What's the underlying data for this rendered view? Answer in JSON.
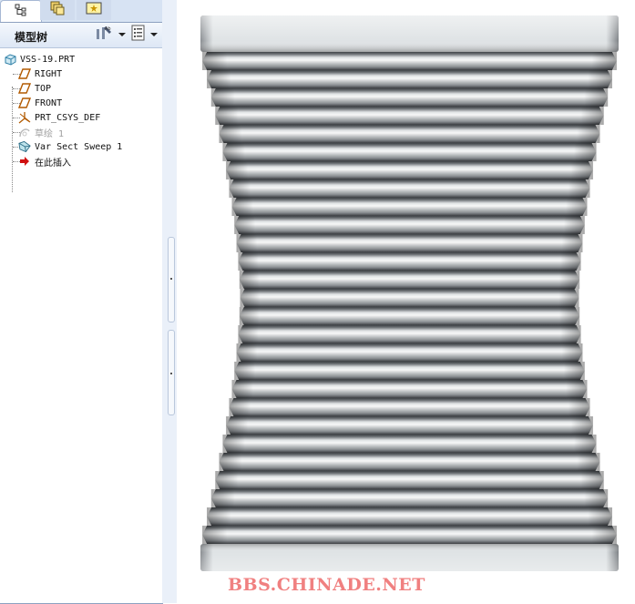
{
  "navigator": {
    "tabs": [
      {
        "name": "model-tree",
        "icon": "model-tree-icon",
        "active": true
      },
      {
        "name": "layers",
        "icon": "layers-icon",
        "active": false
      },
      {
        "name": "favorites",
        "icon": "favorites-icon",
        "active": false
      }
    ]
  },
  "tree_panel": {
    "title": "模型树",
    "settings_icon": "tree-settings-icon",
    "show_icon": "show-menu-icon"
  },
  "tree": {
    "root": "VSS-19.PRT",
    "items": [
      {
        "label": "RIGHT",
        "icon": "datum-plane-icon",
        "disabled": false
      },
      {
        "label": "TOP",
        "icon": "datum-plane-icon",
        "disabled": false
      },
      {
        "label": "FRONT",
        "icon": "datum-plane-icon",
        "disabled": false
      },
      {
        "label": "PRT_CSYS_DEF",
        "icon": "coordinate-system-icon",
        "disabled": false
      },
      {
        "label": "草绘 1",
        "icon": "sketch-icon",
        "disabled": true
      },
      {
        "label": "Var Sect Sweep 1",
        "icon": "sweep-icon",
        "disabled": false
      },
      {
        "label": "在此插入",
        "icon": "insert-here-arrow-icon",
        "disabled": false
      }
    ]
  },
  "graphics": {
    "watermark": "BBS.CHINADE.NET",
    "model_color": "#b8bcbf",
    "rib_count": 27
  }
}
